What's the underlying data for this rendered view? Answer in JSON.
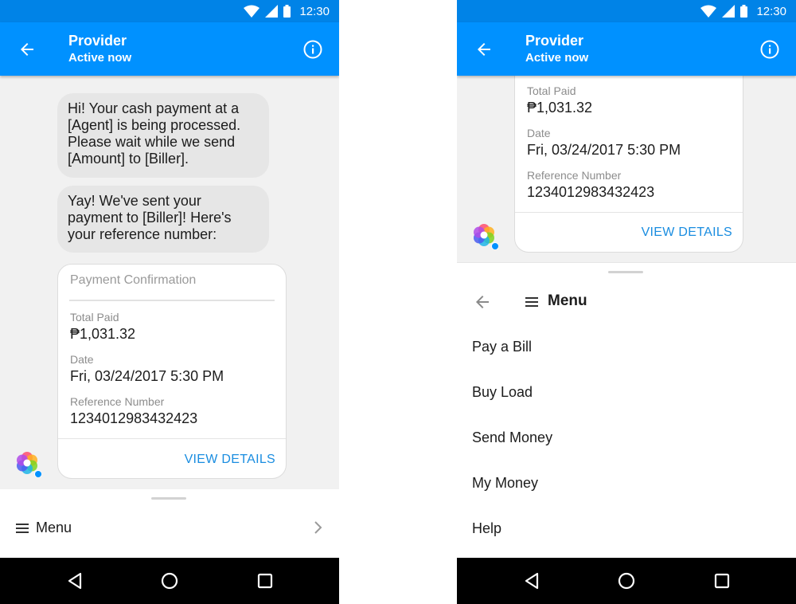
{
  "status": {
    "time": "12:30"
  },
  "header": {
    "title": "Provider",
    "subtitle": "Active now"
  },
  "messages": [
    "Hi! Your cash payment at a [Agent] is being processed. Please wait while we send [Amount] to [Biller].",
    "Yay! We've sent your payment to [Biller]! Here's your reference number:"
  ],
  "card": {
    "header": "Payment Confirmation",
    "fields": [
      {
        "label": "Total Paid",
        "value": "₱1,031.32"
      },
      {
        "label": "Date",
        "value": "Fri, 03/24/2017 5:30 PM"
      },
      {
        "label": "Reference Number",
        "value": "1234012983432423"
      }
    ],
    "action": "VIEW DETAILS"
  },
  "menu": {
    "label": "Menu",
    "items": [
      "Pay a Bill",
      "Buy Load",
      "Send Money",
      "My Money",
      "Help"
    ]
  },
  "colors": {
    "status_bar": "#0083e7",
    "app_bar": "#0091ff",
    "link": "#1a8de0",
    "bubble": "#e6e6e6"
  },
  "icons": {
    "back": "arrow-left-icon",
    "info": "info-icon",
    "avatar": "bot-avatar-icon",
    "menu": "hamburger-icon",
    "chevron": "chevron-right-icon",
    "nav": [
      "nav-back-icon",
      "nav-home-icon",
      "nav-recents-icon"
    ]
  }
}
